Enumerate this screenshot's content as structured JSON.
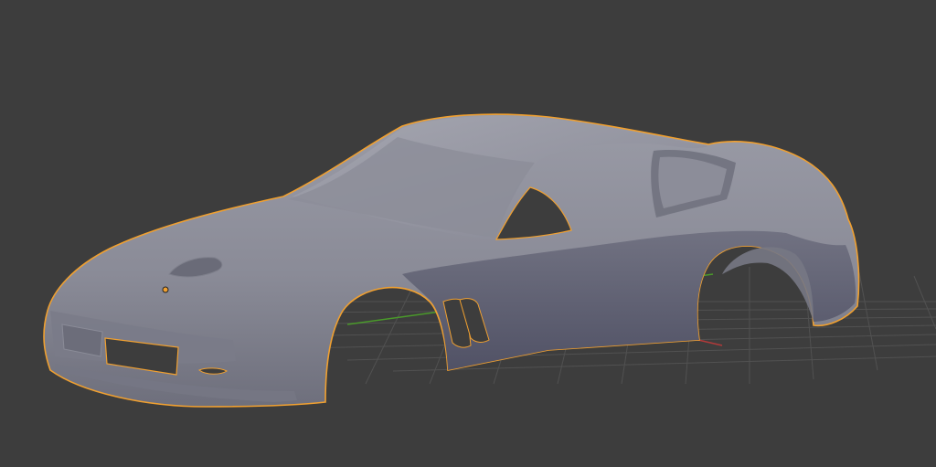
{
  "viewport": {
    "background_color": "#3d3d3d",
    "grid_color": "#555555",
    "x_axis_color": "#b03a3a",
    "y_axis_color": "#4a9a2a"
  },
  "object": {
    "name": "car-body",
    "selected": true,
    "outline_color": "#f0a030",
    "body_color": "#8a8b98",
    "shadow_color": "#55566a",
    "highlight_color": "#a0a1ad",
    "origin_color": "#f0a030"
  }
}
